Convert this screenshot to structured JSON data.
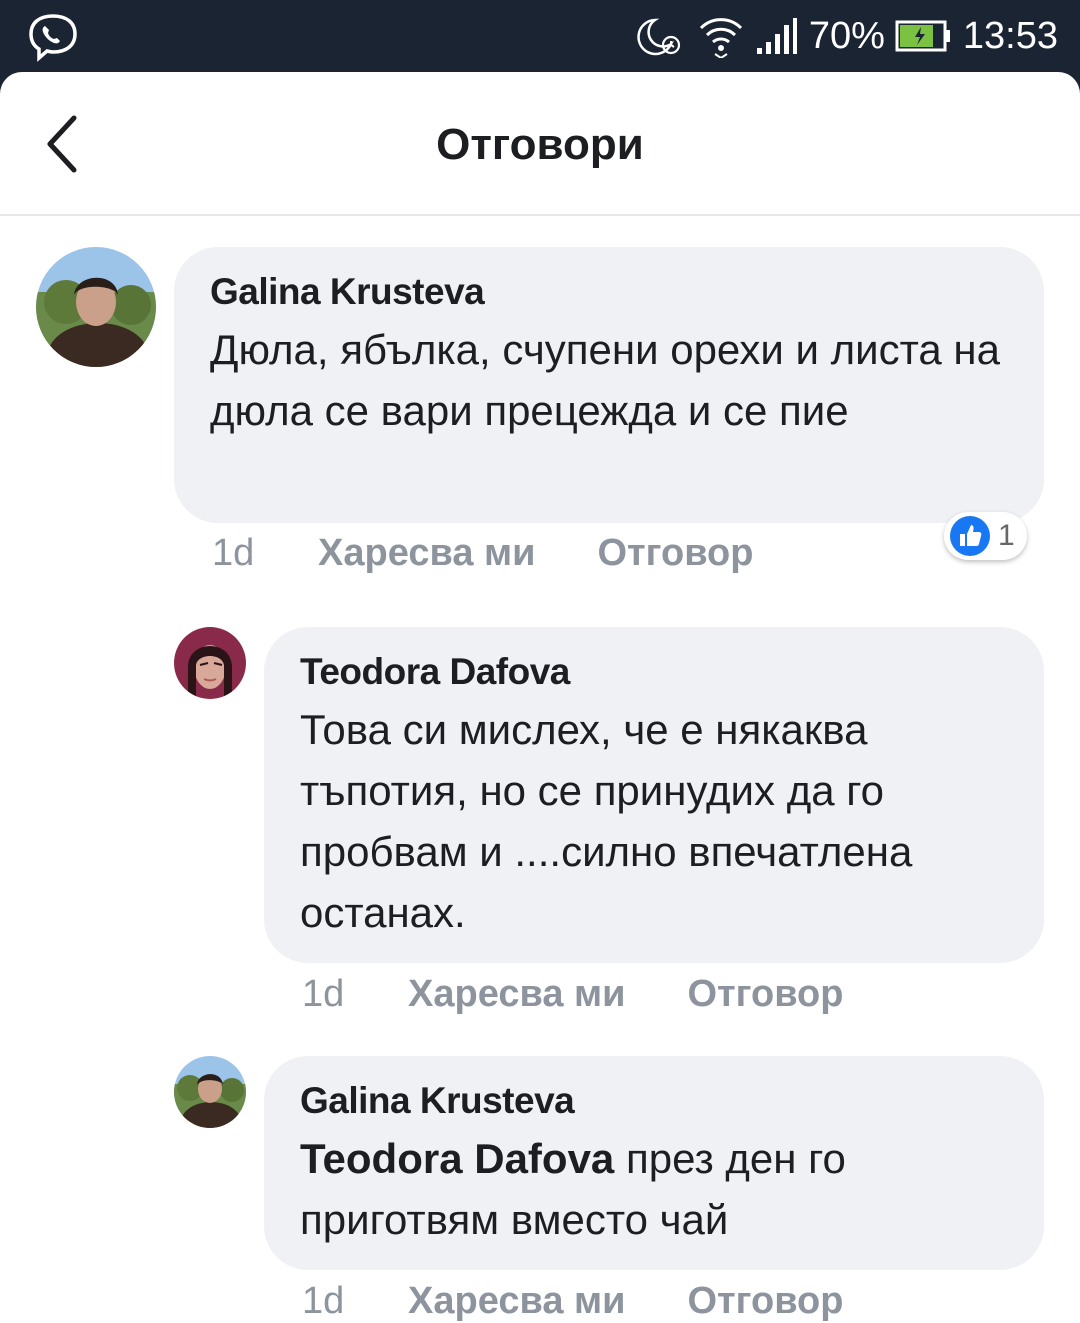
{
  "status_bar": {
    "app_icon": "viber-icon",
    "signal": "signal-icon",
    "battery_percent": "70%",
    "time": "13:53"
  },
  "header": {
    "title": "Отговори",
    "back_icon": "chevron-left-icon"
  },
  "comments": [
    {
      "author": "Galina Krusteva",
      "text": "Дюла, ябълка, счупени орехи и листа на дюла се вари прецежда и се пие",
      "time": "1d",
      "like_label": "Харесва ми",
      "reply_label": "Отговор",
      "reaction_count": "1",
      "reaction_icon": "like-thumb-icon"
    },
    {
      "author": "Teodora Dafova",
      "text": "Това си мислех, че е някаква тъпотия, но се принудих да го пробвам и ....силно впечатлена останах.",
      "time": "1d",
      "like_label": "Харесва ми",
      "reply_label": "Отговор"
    },
    {
      "author": "Galina Krusteva",
      "mention": "Teodora Dafova",
      "text": " през ден го приготвям вместо чай",
      "time": "1d",
      "like_label": "Харесва ми",
      "reply_label": "Отговор"
    }
  ],
  "colors": {
    "status_bar_bg": "#1b2433",
    "bubble_bg": "#f0f1f4",
    "muted_text": "#8d949e",
    "like_blue": "#1877f2",
    "battery_green": "#7cc242"
  }
}
